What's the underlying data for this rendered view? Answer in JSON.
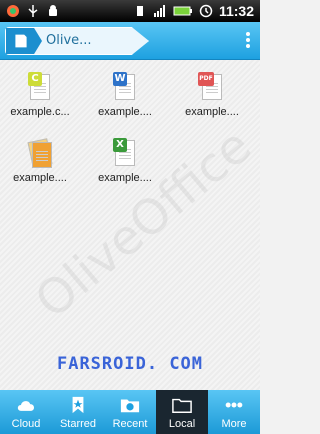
{
  "status": {
    "time": "11:32"
  },
  "topbar": {
    "breadcrumb_label": "Olive..."
  },
  "files": [
    {
      "name": "example.c...",
      "badge": "C",
      "badge_color": "#cddc39"
    },
    {
      "name": "example....",
      "badge": "W",
      "badge_color": "#2e73c9"
    },
    {
      "name": "example....",
      "badge": "PDF",
      "badge_color": "#e05555"
    },
    {
      "name": "example....",
      "badge": "",
      "badge_color": "#f0a133"
    },
    {
      "name": "example....",
      "badge": "X",
      "badge_color": "#3a9a3a"
    }
  ],
  "watermark": {
    "text": "OliveOffice",
    "farsroid": "FARSROID. COM"
  },
  "nav": {
    "items": [
      {
        "label": "Cloud"
      },
      {
        "label": "Starred"
      },
      {
        "label": "Recent"
      },
      {
        "label": "Local"
      },
      {
        "label": "More"
      }
    ]
  },
  "colors": {
    "accent": "#1ea1e0",
    "nav_active": "#1a2630"
  }
}
